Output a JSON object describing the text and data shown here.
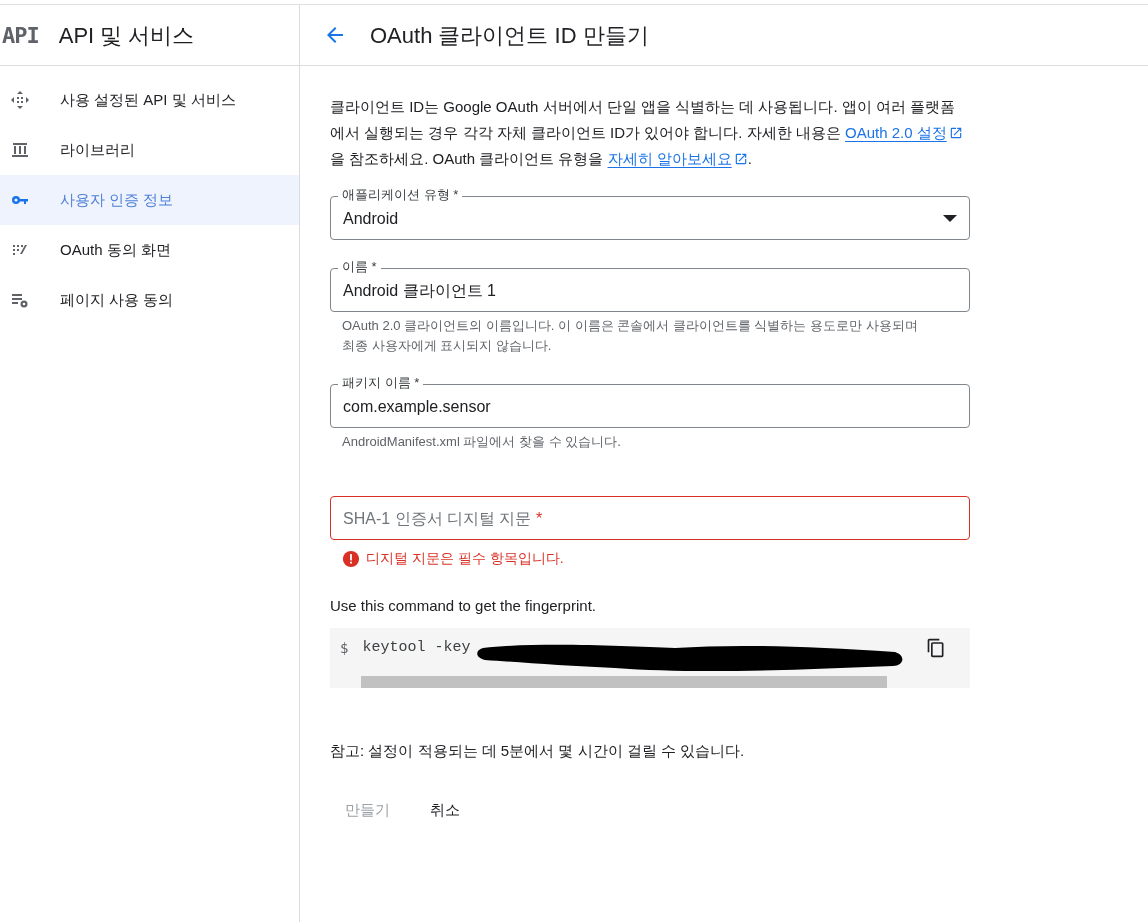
{
  "sidebar": {
    "logo": "API",
    "title": "API 및 서비스",
    "items": [
      {
        "label": "사용 설정된 API 및 서비스",
        "selected": false
      },
      {
        "label": "라이브러리",
        "selected": false
      },
      {
        "label": "사용자 인증 정보",
        "selected": true
      },
      {
        "label": "OAuth 동의 화면",
        "selected": false
      },
      {
        "label": "페이지 사용 동의",
        "selected": false
      }
    ]
  },
  "header": {
    "title": "OAuth 클라이언트 ID 만들기"
  },
  "description": [
    {
      "kind": "text",
      "text": "클라이언트 ID는 Google OAuth 서버에서 단일 앱을 식별하는 데 사용됩니다. 앱이 여러 플랫폼에서 실행되는 경우 각각 자체 클라이언트 ID가 있어야 합니다. 자세한 내용은 "
    },
    {
      "kind": "link",
      "text": "OAuth 2.0 설정"
    },
    {
      "kind": "text",
      "text": "을 참조하세요. OAuth 클라이언트 유형을 "
    },
    {
      "kind": "link",
      "text": "자세히 알아보세요"
    },
    {
      "kind": "text",
      "text": "."
    }
  ],
  "fields": [
    {
      "kind": "select",
      "label": "애플리케이션 유형 *",
      "value": "Android"
    },
    {
      "kind": "text",
      "label": "이름 *",
      "value": "Android 클라이언트 1",
      "hint": "OAuth 2.0 클라이언트의 이름입니다. 이 이름은 콘솔에서 클라이언트를 식별하는 용도로만 사용되며 최종 사용자에게 표시되지 않습니다."
    },
    {
      "kind": "text",
      "label": "패키지 이름 *",
      "value": "com.example.sensor",
      "hint": "AndroidManifest.xml 파일에서 찾을 수 있습니다."
    },
    {
      "kind": "text",
      "placeholder": "SHA-1 인증서 디지털 지문",
      "required_mark": "*",
      "error": "디지털 지문은 필수 항목입니다."
    }
  ],
  "command": {
    "intro": "Use this command to get the fingerprint.",
    "prompt": "$",
    "text": "keytool -key"
  },
  "note": "참고: 설정이 적용되는 데 5분에서 몇 시간이 걸릴 수 있습니다.",
  "buttons": [
    {
      "label": "만들기",
      "disabled": true
    },
    {
      "label": "취소",
      "disabled": false
    }
  ]
}
